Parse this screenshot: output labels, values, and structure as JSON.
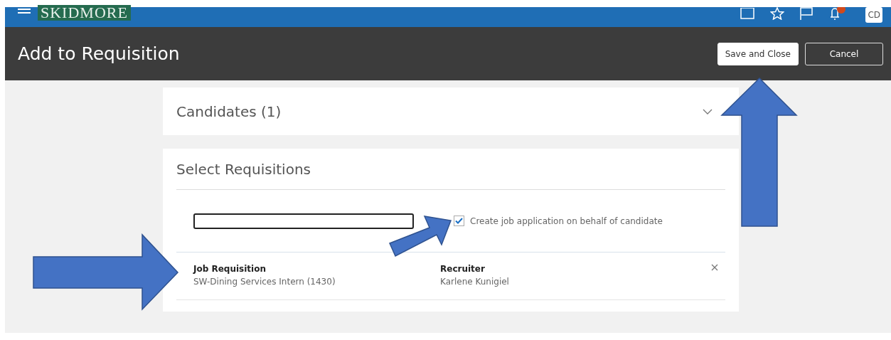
{
  "header": {
    "logo": "SKIDMORE",
    "avatar": "CD"
  },
  "page": {
    "title": "Add to Requisition",
    "buttons": [
      {
        "label": "Save and Close",
        "kind": "primary"
      },
      {
        "label": "Cancel",
        "kind": "secondary"
      }
    ]
  },
  "candidates": {
    "title": "Candidates (1)",
    "expanded": false
  },
  "requisitions": {
    "title": "Select Requisitions",
    "checkbox": {
      "label": "Create job application on behalf of candidate",
      "checked": true
    },
    "rows": [
      {
        "job_label": "Job Requisition",
        "job": "SW-Dining Services Intern (1430)",
        "recruiter_label": "Recruiter",
        "recruiter": "Karlene Kunigiel"
      }
    ]
  }
}
